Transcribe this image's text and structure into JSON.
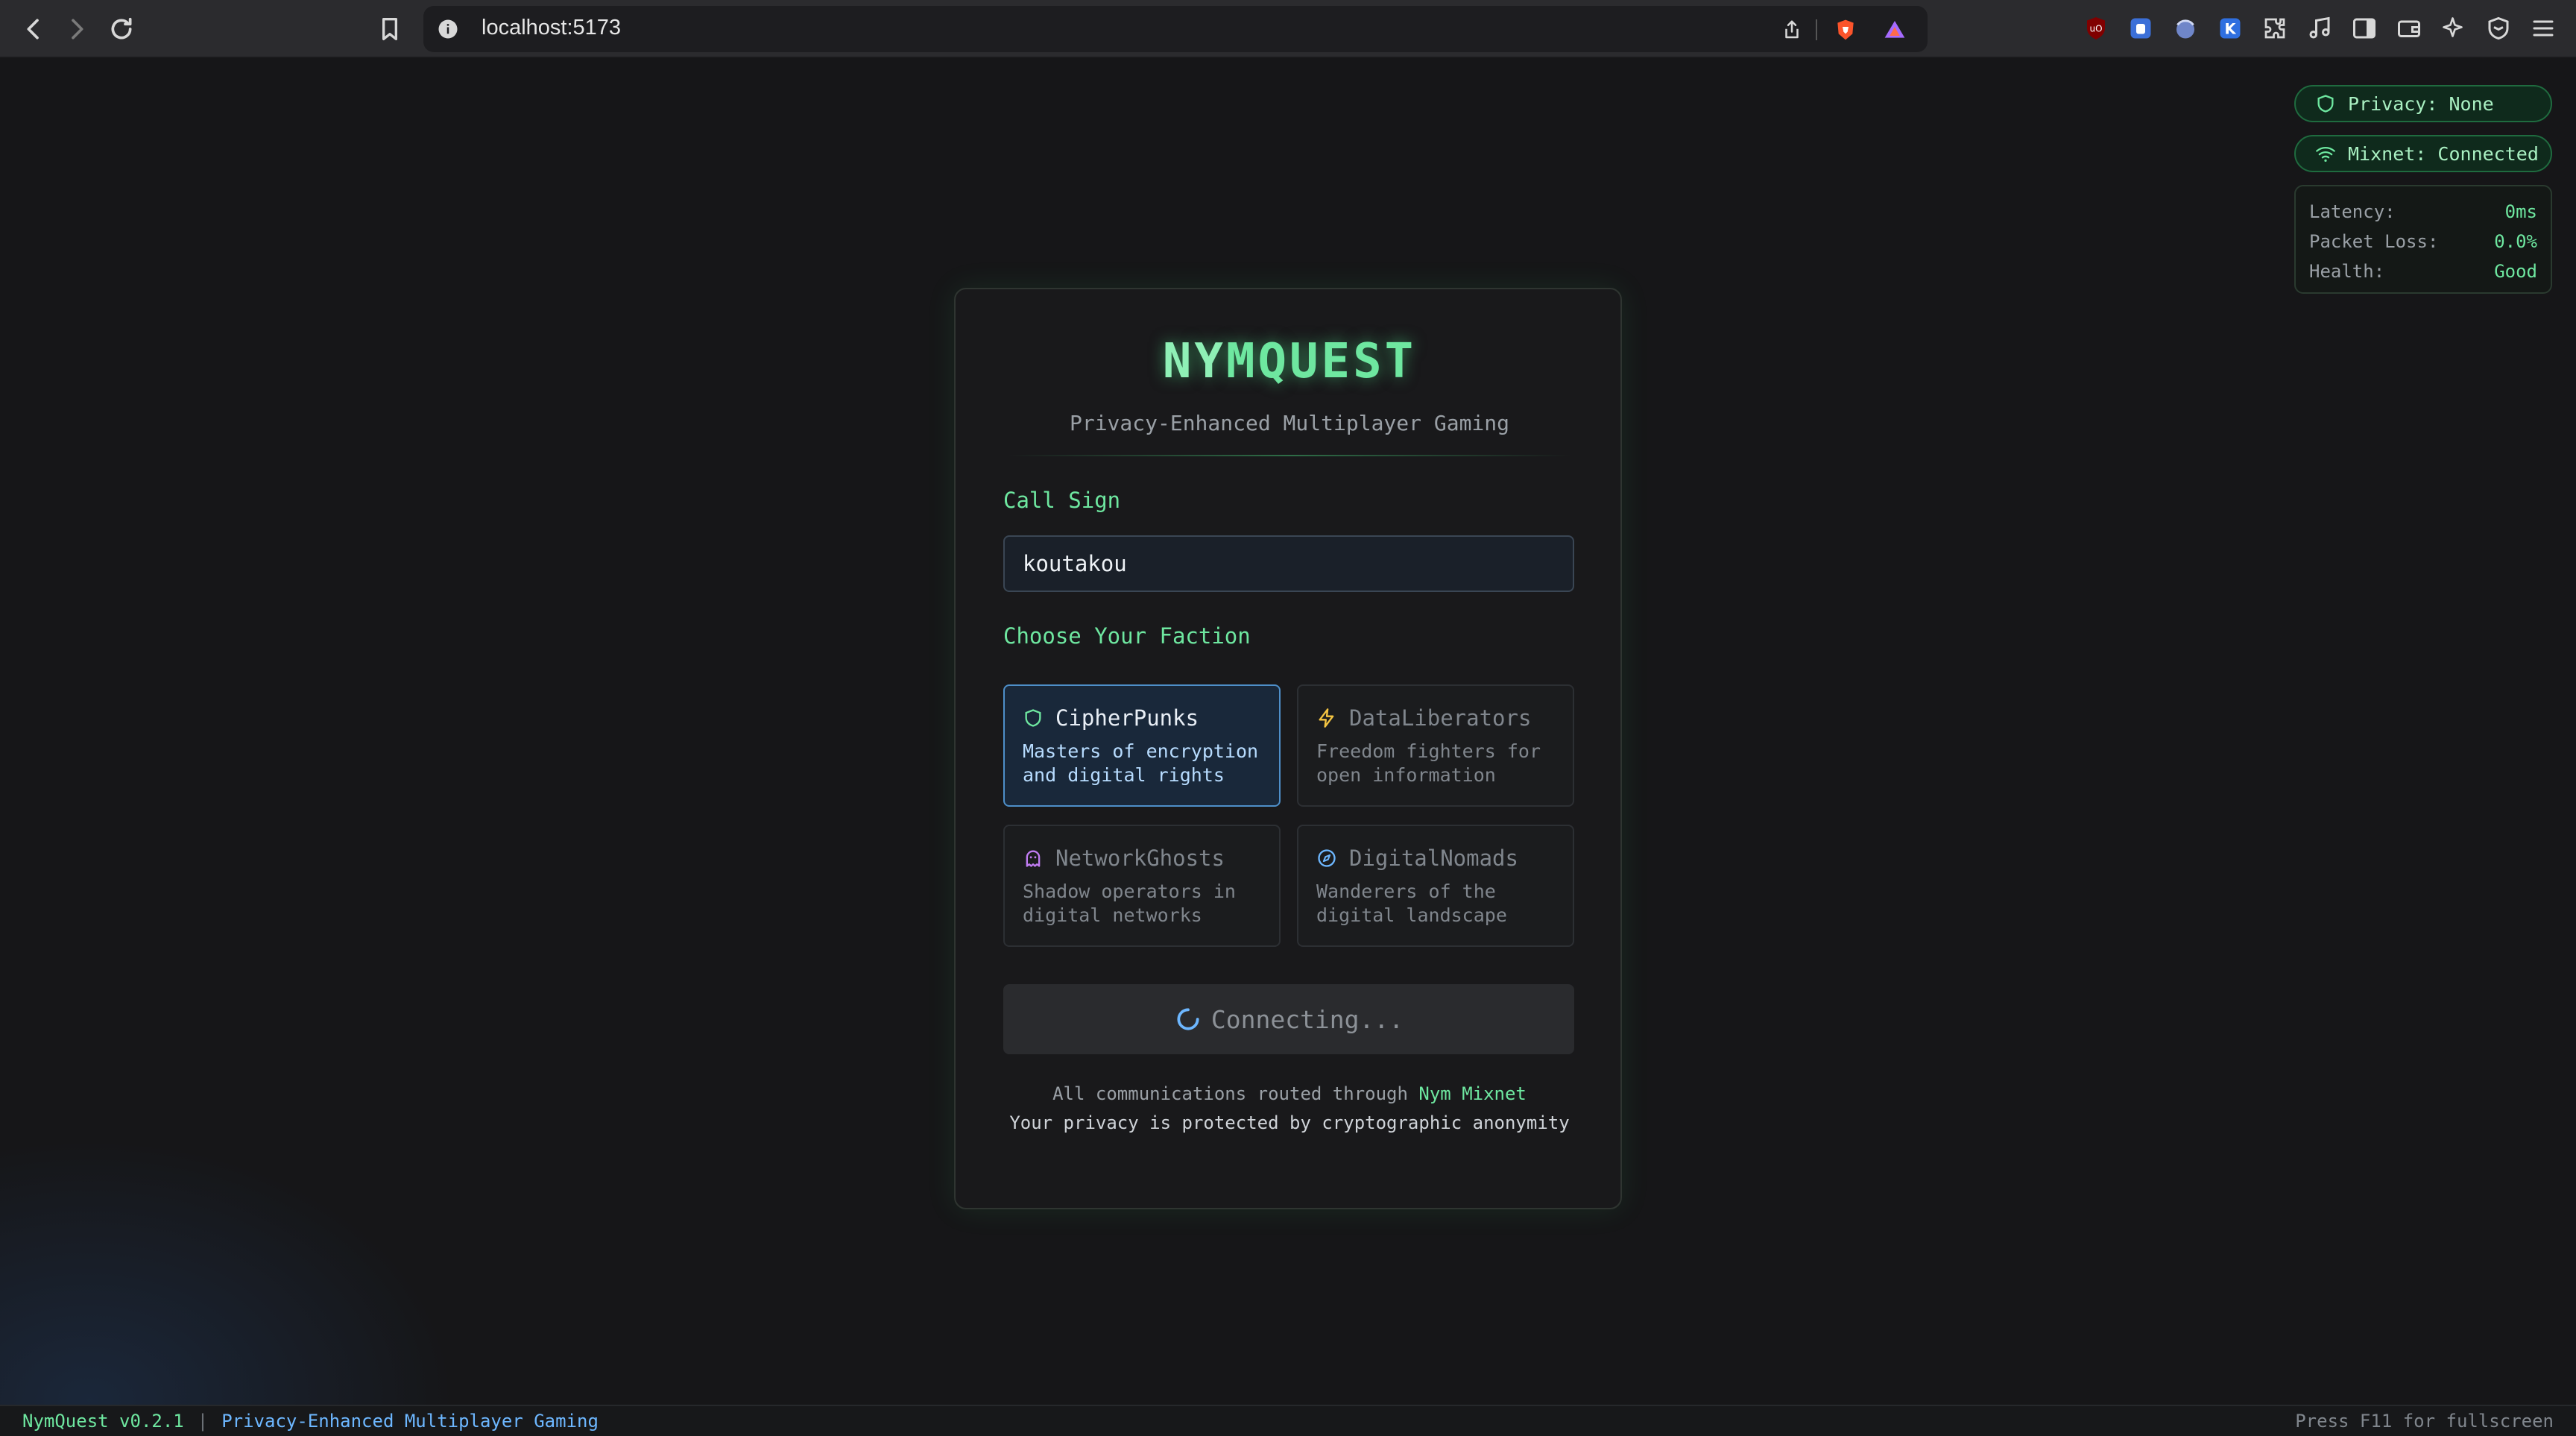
{
  "browser": {
    "url": "localhost:5173"
  },
  "status": {
    "privacy_label": "Privacy: None",
    "mixnet_label": "Mixnet: Connected",
    "metrics": [
      {
        "label": "Latency:",
        "value": "0ms"
      },
      {
        "label": "Packet Loss:",
        "value": "0.0%"
      },
      {
        "label": "Health:",
        "value": "Good"
      }
    ]
  },
  "card": {
    "brand_ny": "NY",
    "brand_rest": "MQUEST",
    "subtitle": "Privacy-Enhanced Multiplayer Gaming",
    "callsign_label": "Call Sign",
    "callsign_value": "koutakou",
    "faction_label": "Choose Your Faction",
    "factions": [
      {
        "name": "CipherPunks",
        "desc": "Masters of encryption and digital rights",
        "icon": "shield-icon",
        "color": "#6ee7a0",
        "selected": true
      },
      {
        "name": "DataLiberators",
        "desc": "Freedom fighters for open information",
        "icon": "lightning-icon",
        "color": "#f5c542",
        "selected": false
      },
      {
        "name": "NetworkGhosts",
        "desc": "Shadow operators in digital networks",
        "icon": "ghost-icon",
        "color": "#c07cf2",
        "selected": false
      },
      {
        "name": "DigitalNomads",
        "desc": "Wanderers of the digital landscape",
        "icon": "compass-icon",
        "color": "#6db7ff",
        "selected": false
      }
    ],
    "connect_label": "Connecting...",
    "footnote_prefix": "All communications routed through ",
    "footnote_highlight": "Nym Mixnet",
    "footnote_line2": "Your privacy is protected by cryptographic anonymity"
  },
  "statusbar": {
    "version": "NymQuest v0.2.1",
    "separator": "|",
    "tagline": "Privacy-Enhanced Multiplayer Gaming",
    "hint": "Press F11 for fullscreen"
  },
  "colors": {
    "accent_green": "#6ee7a0",
    "selected_blue": "#4e8fc9",
    "link_blue": "#6db7ff"
  }
}
